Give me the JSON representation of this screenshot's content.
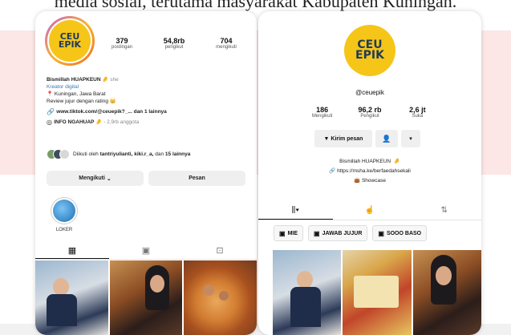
{
  "caption": "media sosial, terutama masyarakat Kabupaten Kuningan.",
  "instagram": {
    "logo_text_1": "CEU",
    "logo_text_2": "EPIK",
    "stats": [
      {
        "num": "379",
        "label": "postingan"
      },
      {
        "num": "54,8rb",
        "label": "pengikut"
      },
      {
        "num": "704",
        "label": "mengikuti"
      }
    ],
    "bio": {
      "name": "Bismillah HUAPKEUN",
      "pronoun": "she",
      "category": "Kreator digital",
      "location": "📍 Kuningan, Jawa Barat",
      "tagline": "Review jujur dengan rating",
      "link": "www.tiktok.com/@ceuepik?_...",
      "link_more": "dan 1 lainnya",
      "channel": "INFO NGAHUAP",
      "channel_members": "2,9rb anggota"
    },
    "followed_by": {
      "prefix": "Diikuti oleh",
      "names": "tantriyulianti, kiki.r_a,",
      "mid": "dan",
      "others": "15 lainnya"
    },
    "buttons": {
      "following": "Mengikuti",
      "message": "Pesan"
    },
    "highlight": {
      "label": "LOKER"
    }
  },
  "tiktok": {
    "logo_text_1": "CEU",
    "logo_text_2": "EPIK",
    "handle": "@ceuepik",
    "stats": [
      {
        "num": "186",
        "label": "Mengikuti"
      },
      {
        "num": "96,2 rb",
        "label": "Pengikut"
      },
      {
        "num": "2,6 jt",
        "label": "Suka"
      }
    ],
    "buttons": {
      "message": "Kirim pesan"
    },
    "bio": {
      "name": "Bismillah HUAPKEUN",
      "link": "https://msha.ke/berfaedahsekali",
      "showcase": "Showcase"
    },
    "playlists": [
      "MIE",
      "JAWAB JUJUR",
      "SOOO BASO"
    ]
  },
  "colors": {
    "band": "#fde6e6",
    "logo_yellow": "#f5c518",
    "logo_text": "#1f3a5a"
  }
}
